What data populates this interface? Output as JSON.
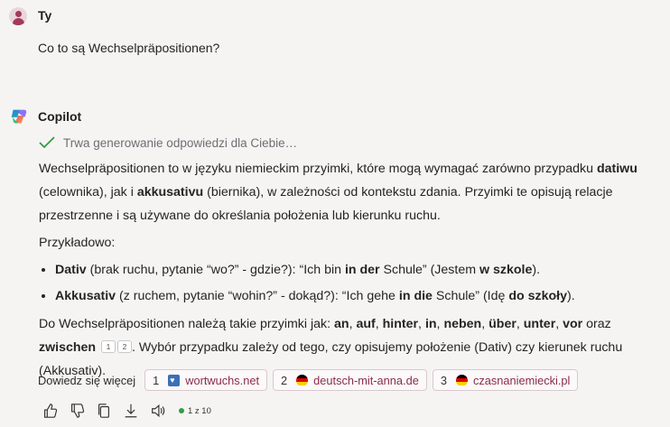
{
  "user": {
    "name": "Ty",
    "message": "Co to są Wechselpräpositionen?"
  },
  "assistant": {
    "name": "Copilot",
    "status": "Trwa generowanie odpowiedzi dla Ciebie…",
    "p1": {
      "t1": "Wechselpräpositionen to w języku niemieckim przyimki, które mogą wymagać zarówno przypadku ",
      "b1": "datiwu",
      "t2": " (celownika), jak i ",
      "b2": "akkusativu",
      "t3": " (biernika), w zależności od kontekstu zdania. Przyimki te opisują relacje przestrzenne i są używane do określania położenia lub kierunku ruchu."
    },
    "p2": "Przykładowo:",
    "bullets": [
      {
        "b0": "Dativ",
        "t1": " (brak ruchu, pytanie “wo?” - gdzie?): “Ich bin ",
        "b1": "in der",
        "t2": " Schule” (Jestem ",
        "b2": "w szkole",
        "t3": ")."
      },
      {
        "b0": "Akkusativ",
        "t1": " (z ruchem, pytanie “wohin?” - dokąd?): “Ich gehe ",
        "b1": "in die",
        "t2": " Schule” (Idę ",
        "b2": "do szkoły",
        "t3": ")."
      }
    ],
    "p3": {
      "t1": "Do Wechselpräpositionen należą takie przyimki jak: ",
      "b1": "an",
      "s1": ", ",
      "b2": "auf",
      "s2": ", ",
      "b3": "hinter",
      "s3": ", ",
      "b4": "in",
      "s4": ", ",
      "b5": "neben",
      "s5": ", ",
      "b6": "über",
      "s6": ", ",
      "b7": "unter",
      "s7": ", ",
      "b8": "vor",
      "t2": " oraz ",
      "b9": "zwischen",
      "ref1": "1",
      "ref2": "2",
      "t3": ". Wybór przypadku zależy od tego, czy opisujemy położenie (Dativ) czy kierunek ruchu (Akkusativ)."
    }
  },
  "learn_more": {
    "label": "Dowiedz się więcej",
    "sources": [
      {
        "num": "1",
        "site": "wortwuchs.net"
      },
      {
        "num": "2",
        "site": "deutsch-mit-anna.de"
      },
      {
        "num": "3",
        "site": "czasnaniemiecki.pl"
      }
    ]
  },
  "actions": {
    "icons": [
      "thumbs-up-icon",
      "thumbs-down-icon",
      "copy-icon",
      "download-icon",
      "speaker-icon"
    ],
    "pager": "1 z 10"
  },
  "colors": {
    "background": "#f6f4f3",
    "source_text": "#8a2c4d",
    "check": "#2f9e44",
    "user_avatar": "#a23a5d"
  }
}
